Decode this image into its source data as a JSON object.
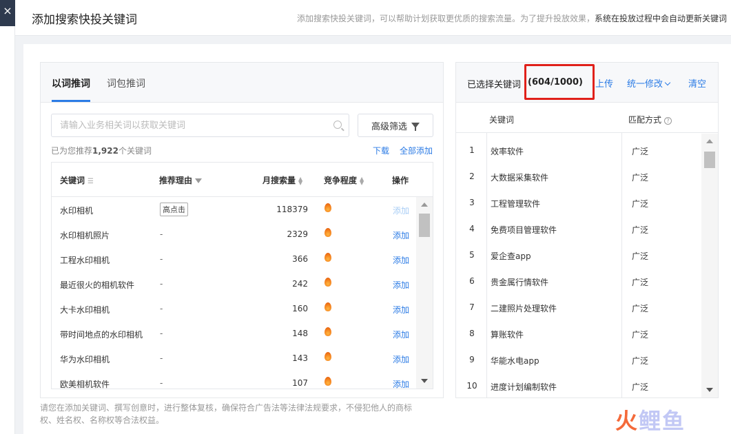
{
  "header": {
    "title": "添加搜索快投关键词",
    "desc_plain": "添加搜索快投关键词，可以帮助计划获取更优质的搜索流量。为了提升投放效果，",
    "desc_bold": "系统在投放过程中会自动更新关键词"
  },
  "close_label": "×",
  "left": {
    "tabs": [
      "以词推词",
      "词包推词"
    ],
    "search_placeholder": "请输入业务相关词以获取关键词",
    "advanced_filter": "高级筛选",
    "rec_prefix": "已为您推荐",
    "rec_count": "1,922",
    "rec_suffix": "个关键词",
    "download": "下载",
    "add_all": "全部添加",
    "columns": {
      "keyword": "关键词",
      "reason": "推荐理由",
      "volume": "月搜索量",
      "competition": "竞争程度",
      "action": "操作"
    },
    "rows": [
      {
        "keyword": "水印相机",
        "reason": "高点击",
        "volume": "118379",
        "action": "添加"
      },
      {
        "keyword": "水印相机照片",
        "reason": "-",
        "volume": "2329",
        "action": "添加"
      },
      {
        "keyword": "工程水印相机",
        "reason": "-",
        "volume": "366",
        "action": "添加"
      },
      {
        "keyword": "最近很火的相机软件",
        "reason": "-",
        "volume": "242",
        "action": "添加"
      },
      {
        "keyword": "大卡水印相机",
        "reason": "-",
        "volume": "160",
        "action": "添加"
      },
      {
        "keyword": "带时间地点的水印相机",
        "reason": "-",
        "volume": "148",
        "action": "添加"
      },
      {
        "keyword": "华为水印相机",
        "reason": "-",
        "volume": "143",
        "action": "添加"
      },
      {
        "keyword": "欧美相机软件",
        "reason": "-",
        "volume": "107",
        "action": "添加"
      }
    ]
  },
  "footnote": "请您在添加关键词、撰写创意时，进行整体复核，确保符合广告法等法律法规要求，不侵犯他人的商标权、姓名权、名称权等合法权益。",
  "right": {
    "label": "已选择关键词",
    "count": "(604/1000)",
    "upload": "上传",
    "batch_edit": "统一修改",
    "clear": "清空",
    "columns": {
      "keyword": "关键词",
      "match": "匹配方式"
    },
    "rows": [
      {
        "idx": "1",
        "keyword": "效率软件",
        "match": "广泛"
      },
      {
        "idx": "2",
        "keyword": "大数据采集软件",
        "match": "广泛"
      },
      {
        "idx": "3",
        "keyword": "工程管理软件",
        "match": "广泛"
      },
      {
        "idx": "4",
        "keyword": "免费项目管理软件",
        "match": "广泛"
      },
      {
        "idx": "5",
        "keyword": "爱企查app",
        "match": "广泛"
      },
      {
        "idx": "6",
        "keyword": "贵金属行情软件",
        "match": "广泛"
      },
      {
        "idx": "7",
        "keyword": "二建照片处理软件",
        "match": "广泛"
      },
      {
        "idx": "8",
        "keyword": "算账软件",
        "match": "广泛"
      },
      {
        "idx": "9",
        "keyword": "华能水电app",
        "match": "广泛"
      },
      {
        "idx": "10",
        "keyword": "进度计划编制软件",
        "match": "广泛"
      }
    ]
  },
  "watermark": {
    "part1": "火",
    "part2": "鲤鱼"
  },
  "colors": {
    "accent": "#2b7be5",
    "highlight_box": "#e0201a",
    "fire": "#f27a1a"
  }
}
